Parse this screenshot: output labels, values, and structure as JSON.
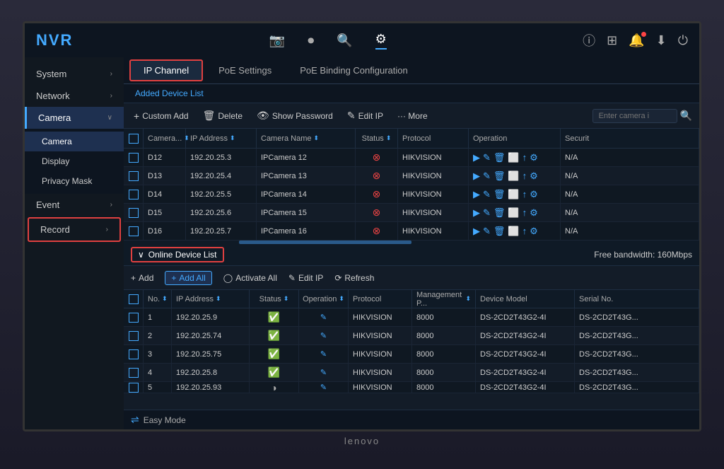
{
  "app": {
    "logo": "NVR",
    "brand": "lenovo"
  },
  "top_nav": {
    "items": [
      {
        "id": "camera-icon",
        "icon": "📷",
        "label": ""
      },
      {
        "id": "playback-icon",
        "icon": "⏺",
        "label": ""
      },
      {
        "id": "search-icon",
        "icon": "🔍",
        "label": ""
      },
      {
        "id": "settings-icon",
        "icon": "⚙",
        "label": "",
        "active": true
      }
    ]
  },
  "sidebar": {
    "items": [
      {
        "id": "system",
        "label": "System",
        "arrow": "›"
      },
      {
        "id": "network",
        "label": "Network",
        "arrow": "›"
      },
      {
        "id": "camera",
        "label": "Camera",
        "arrow": "∨",
        "active": true
      }
    ],
    "sub_items": [
      {
        "id": "camera-sub",
        "label": "Camera",
        "active": true
      },
      {
        "id": "display-sub",
        "label": "Display"
      },
      {
        "id": "privacy-mask-sub",
        "label": "Privacy Mask"
      }
    ]
  },
  "tabs": [
    {
      "id": "ip-channel",
      "label": "IP Channel",
      "active": true,
      "highlighted": true
    },
    {
      "id": "poe-settings",
      "label": "PoE Settings"
    },
    {
      "id": "poe-binding",
      "label": "PoE Binding Configuration"
    }
  ],
  "sub_tabs": [
    {
      "id": "added-device-list",
      "label": "Added Device List"
    }
  ],
  "toolbar": {
    "custom_add": "+ Custom Add",
    "delete": "Delete",
    "show_password": "Show Password",
    "edit_ip": "Edit IP",
    "more": "··· More",
    "search_placeholder": "Enter camera i"
  },
  "table": {
    "headers": [
      "",
      "Camera...",
      "IP Address ⬍",
      "Camera Name",
      "Status ⬍",
      "Protocol",
      "Operation",
      "Securit"
    ],
    "rows": [
      {
        "check": false,
        "cam": "D12",
        "ip": "192.20.25.3",
        "name": "IPCamera 12",
        "status": "error",
        "proto": "HIKVISION",
        "ops": [
          "▶",
          "✎",
          "🗑",
          "⬜",
          "↑",
          "⚙"
        ],
        "sec": "N/A"
      },
      {
        "check": false,
        "cam": "D13",
        "ip": "192.20.25.4",
        "name": "IPCamera 13",
        "status": "error",
        "proto": "HIKVISION",
        "ops": [
          "▶",
          "✎",
          "🗑",
          "⬜",
          "↑",
          "⚙"
        ],
        "sec": "N/A"
      },
      {
        "check": false,
        "cam": "D14",
        "ip": "192.20.25.5",
        "name": "IPCamera 14",
        "status": "error",
        "proto": "HIKVISION",
        "ops": [
          "▶",
          "✎",
          "🗑",
          "⬜",
          "↑",
          "⚙"
        ],
        "sec": "N/A"
      },
      {
        "check": false,
        "cam": "D15",
        "ip": "192.20.25.6",
        "name": "IPCamera 15",
        "status": "error",
        "proto": "HIKVISION",
        "ops": [
          "▶",
          "✎",
          "🗑",
          "⬜",
          "↑",
          "⚙"
        ],
        "sec": "N/A"
      },
      {
        "check": false,
        "cam": "D16",
        "ip": "192.20.25.7",
        "name": "IPCamera 16",
        "status": "error",
        "proto": "HIKVISION",
        "ops": [
          "▶",
          "✎",
          "🗑",
          "⬜",
          "↑",
          "⚙"
        ],
        "sec": "N/A"
      }
    ]
  },
  "online_section": {
    "title": "Online Device List",
    "bandwidth": "Free bandwidth: 160Mbps",
    "toolbar": {
      "add": "+ Add",
      "add_all": "+ Add All",
      "activate_all": "Activate All",
      "edit_ip": "Edit IP",
      "refresh": "Refresh"
    },
    "table": {
      "headers": [
        "",
        "No.",
        "IP Address ⬍",
        "Status ⬍",
        "Operation ⬍",
        "Protocol",
        "Management P... ⬍",
        "Device Model",
        "Serial No."
      ],
      "rows": [
        {
          "check": false,
          "no": "1",
          "ip": "192.20.25.9",
          "status": "ok",
          "op": "✎",
          "proto": "HIKVISION",
          "mgmt": "8000",
          "model": "DS-2CD2T43G2-4I",
          "serial": "DS-2CD2T43G..."
        },
        {
          "check": false,
          "no": "2",
          "ip": "192.20.25.74",
          "status": "ok",
          "op": "✎",
          "proto": "HIKVISION",
          "mgmt": "8000",
          "model": "DS-2CD2T43G2-4I",
          "serial": "DS-2CD2T43G..."
        },
        {
          "check": false,
          "no": "3",
          "ip": "192.20.25.75",
          "status": "ok",
          "op": "✎",
          "proto": "HIKVISION",
          "mgmt": "8000",
          "model": "DS-2CD2T43G2-4I",
          "serial": "DS-2CD2T43G..."
        },
        {
          "check": false,
          "no": "4",
          "ip": "192.20.25.8",
          "status": "ok",
          "op": "✎",
          "proto": "HIKVISION",
          "mgmt": "8000",
          "model": "DS-2CD2T43G2-4I",
          "serial": "DS-2CD2T43G..."
        },
        {
          "check": false,
          "no": "5",
          "ip": "192.20.25.93",
          "status": "partial",
          "op": "✎",
          "proto": "HIKVISION",
          "mgmt": "8000",
          "model": "DS-2CD2T43G2-4I",
          "serial": "DS-2CD2T43G..."
        }
      ]
    }
  },
  "record_item": {
    "label": "Record",
    "arrow": "›"
  }
}
